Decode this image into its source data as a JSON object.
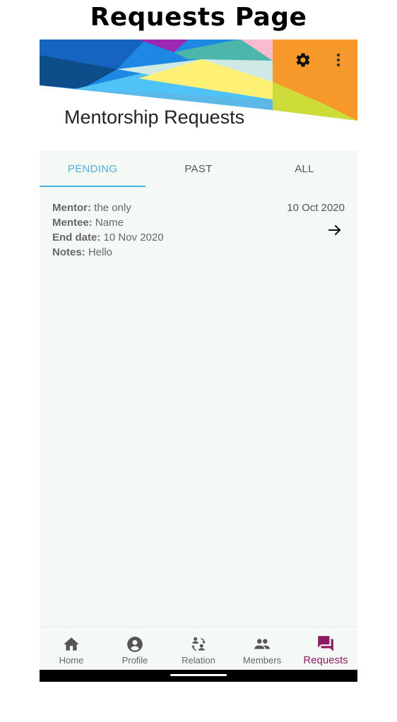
{
  "caption": "Requests Page",
  "header": {
    "title": "Mentorship Requests",
    "settings_icon": "gear-icon",
    "menu_icon": "more-vert-icon",
    "banner_colors": [
      "#1565c0",
      "#1e88e5",
      "#4fc3f7",
      "#fff176",
      "#cddc39",
      "#f7992a",
      "#f8bbd0",
      "#4db6ac",
      "#9c27b0"
    ]
  },
  "tabs": [
    {
      "label": "PENDING",
      "active": true
    },
    {
      "label": "PAST",
      "active": false
    },
    {
      "label": "ALL",
      "active": false
    }
  ],
  "request": {
    "mentor_label": "Mentor:",
    "mentor_value": "the only",
    "mentee_label": "Mentee:",
    "mentee_value": "Name",
    "end_label": "End date:",
    "end_value": "10 Nov 2020",
    "notes_label": "Notes:",
    "notes_value": "Hello",
    "date": "10 Oct 2020",
    "arrow_icon": "arrow-forward-icon"
  },
  "nav": [
    {
      "label": "Home",
      "icon": "home-icon",
      "active": false
    },
    {
      "label": "Profile",
      "icon": "account-circle-icon",
      "active": false
    },
    {
      "label": "Relation",
      "icon": "relation-icon",
      "active": false
    },
    {
      "label": "Members",
      "icon": "members-icon",
      "active": false
    },
    {
      "label": "Requests",
      "icon": "requests-icon",
      "active": true
    }
  ],
  "colors": {
    "accent_tab": "#4ab0de",
    "active_nav": "#8a1c64",
    "background": "#f5f9f5"
  }
}
